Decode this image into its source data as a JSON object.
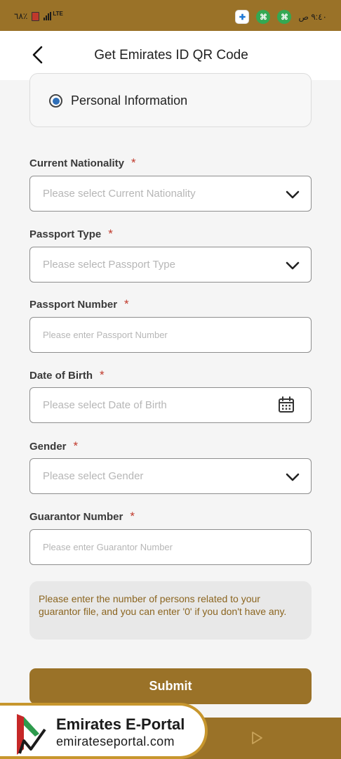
{
  "status_bar": {
    "battery_text": "٦٨٪",
    "network": "LTE",
    "time": "٩:٤٠ ص"
  },
  "header": {
    "title": "Get Emirates ID QR Code"
  },
  "selection": {
    "option_label": "Personal Information"
  },
  "form": {
    "fields": [
      {
        "label": "Current Nationality",
        "required_mark": "*",
        "placeholder": "Please select Current Nationality",
        "type": "select"
      },
      {
        "label": "Passport Type",
        "required_mark": "*",
        "placeholder": "Please select Passport Type",
        "type": "select"
      },
      {
        "label": "Passport Number",
        "required_mark": "*",
        "placeholder": "Please enter Passport Number",
        "type": "text"
      },
      {
        "label": "Date of Birth",
        "required_mark": "*",
        "placeholder": "Please select Date of Birth",
        "type": "date"
      },
      {
        "label": "Gender",
        "required_mark": "*",
        "placeholder": "Please select Gender",
        "type": "select"
      },
      {
        "label": "Guarantor Number",
        "required_mark": "*",
        "placeholder": "Please enter Guarantor Number",
        "type": "text"
      }
    ],
    "guarantor_note": "Please enter the number of persons related to your guarantor file, and you can enter '0' if you don't have any.",
    "submit_label": "Submit"
  },
  "watermark": {
    "title": "Emirates E-Portal",
    "subtitle": "emirateseportal.com"
  },
  "colors": {
    "brand_gold": "#9a7228",
    "required_red": "#c0392b",
    "radio_blue": "#2f6fb8",
    "note_text": "#8b6520"
  },
  "icons": {
    "back": "chevron-left-icon",
    "select": "chevron-down-icon",
    "date": "calendar-icon",
    "nav": "play-icon"
  }
}
